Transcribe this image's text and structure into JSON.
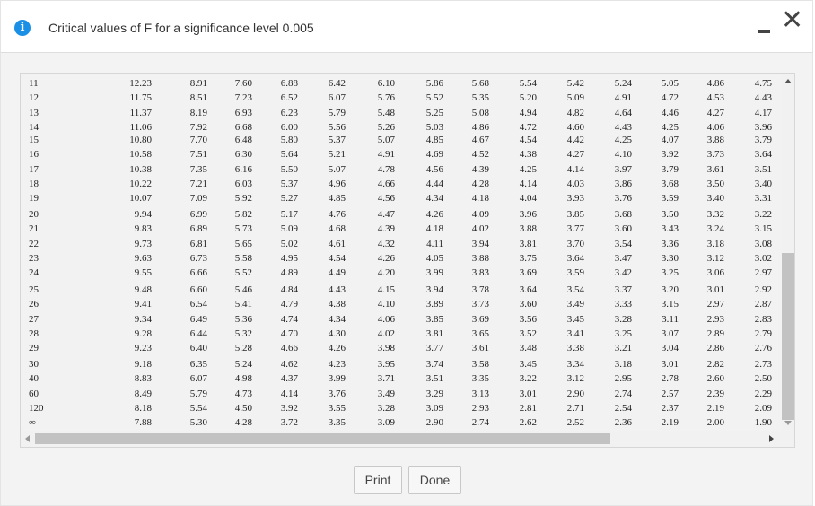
{
  "dialog": {
    "title": "Critical values of F for a significance level 0.005",
    "info_icon": "info-icon",
    "info_glyph": "i",
    "close_glyph": "✕"
  },
  "table": {
    "groups": [
      {
        "rows": [
          {
            "df": "11",
            "values": [
              "12.23",
              "8.91",
              "7.60",
              "6.88",
              "6.42",
              "6.10",
              "5.86",
              "5.68",
              "5.54",
              "5.42",
              "5.24",
              "5.05",
              "4.86",
              "4.75"
            ]
          },
          {
            "df": "12",
            "values": [
              "11.75",
              "8.51",
              "7.23",
              "6.52",
              "6.07",
              "5.76",
              "5.52",
              "5.35",
              "5.20",
              "5.09",
              "4.91",
              "4.72",
              "4.53",
              "4.43"
            ]
          },
          {
            "df": "13",
            "values": [
              "11.37",
              "8.19",
              "6.93",
              "6.23",
              "5.79",
              "5.48",
              "5.25",
              "5.08",
              "4.94",
              "4.82",
              "4.64",
              "4.46",
              "4.27",
              "4.17"
            ]
          },
          {
            "df": "14",
            "values": [
              "11.06",
              "7.92",
              "6.68",
              "6.00",
              "5.56",
              "5.26",
              "5.03",
              "4.86",
              "4.72",
              "4.60",
              "4.43",
              "4.25",
              "4.06",
              "3.96"
            ]
          }
        ]
      },
      {
        "rows": [
          {
            "df": "15",
            "values": [
              "10.80",
              "7.70",
              "6.48",
              "5.80",
              "5.37",
              "5.07",
              "4.85",
              "4.67",
              "4.54",
              "4.42",
              "4.25",
              "4.07",
              "3.88",
              "3.79"
            ]
          },
          {
            "df": "16",
            "values": [
              "10.58",
              "7.51",
              "6.30",
              "5.64",
              "5.21",
              "4.91",
              "4.69",
              "4.52",
              "4.38",
              "4.27",
              "4.10",
              "3.92",
              "3.73",
              "3.64"
            ]
          },
          {
            "df": "17",
            "values": [
              "10.38",
              "7.35",
              "6.16",
              "5.50",
              "5.07",
              "4.78",
              "4.56",
              "4.39",
              "4.25",
              "4.14",
              "3.97",
              "3.79",
              "3.61",
              "3.51"
            ]
          },
          {
            "df": "18",
            "values": [
              "10.22",
              "7.21",
              "6.03",
              "5.37",
              "4.96",
              "4.66",
              "4.44",
              "4.28",
              "4.14",
              "4.03",
              "3.86",
              "3.68",
              "3.50",
              "3.40"
            ]
          },
          {
            "df": "19",
            "values": [
              "10.07",
              "7.09",
              "5.92",
              "5.27",
              "4.85",
              "4.56",
              "4.34",
              "4.18",
              "4.04",
              "3.93",
              "3.76",
              "3.59",
              "3.40",
              "3.31"
            ]
          }
        ]
      },
      {
        "rows": [
          {
            "df": "20",
            "values": [
              "9.94",
              "6.99",
              "5.82",
              "5.17",
              "4.76",
              "4.47",
              "4.26",
              "4.09",
              "3.96",
              "3.85",
              "3.68",
              "3.50",
              "3.32",
              "3.22"
            ]
          },
          {
            "df": "21",
            "values": [
              "9.83",
              "6.89",
              "5.73",
              "5.09",
              "4.68",
              "4.39",
              "4.18",
              "4.02",
              "3.88",
              "3.77",
              "3.60",
              "3.43",
              "3.24",
              "3.15"
            ]
          },
          {
            "df": "22",
            "values": [
              "9.73",
              "6.81",
              "5.65",
              "5.02",
              "4.61",
              "4.32",
              "4.11",
              "3.94",
              "3.81",
              "3.70",
              "3.54",
              "3.36",
              "3.18",
              "3.08"
            ]
          },
          {
            "df": "23",
            "values": [
              "9.63",
              "6.73",
              "5.58",
              "4.95",
              "4.54",
              "4.26",
              "4.05",
              "3.88",
              "3.75",
              "3.64",
              "3.47",
              "3.30",
              "3.12",
              "3.02"
            ]
          },
          {
            "df": "24",
            "values": [
              "9.55",
              "6.66",
              "5.52",
              "4.89",
              "4.49",
              "4.20",
              "3.99",
              "3.83",
              "3.69",
              "3.59",
              "3.42",
              "3.25",
              "3.06",
              "2.97"
            ]
          }
        ]
      },
      {
        "rows": [
          {
            "df": "25",
            "values": [
              "9.48",
              "6.60",
              "5.46",
              "4.84",
              "4.43",
              "4.15",
              "3.94",
              "3.78",
              "3.64",
              "3.54",
              "3.37",
              "3.20",
              "3.01",
              "2.92"
            ]
          },
          {
            "df": "26",
            "values": [
              "9.41",
              "6.54",
              "5.41",
              "4.79",
              "4.38",
              "4.10",
              "3.89",
              "3.73",
              "3.60",
              "3.49",
              "3.33",
              "3.15",
              "2.97",
              "2.87"
            ]
          },
          {
            "df": "27",
            "values": [
              "9.34",
              "6.49",
              "5.36",
              "4.74",
              "4.34",
              "4.06",
              "3.85",
              "3.69",
              "3.56",
              "3.45",
              "3.28",
              "3.11",
              "2.93",
              "2.83"
            ]
          },
          {
            "df": "28",
            "values": [
              "9.28",
              "6.44",
              "5.32",
              "4.70",
              "4.30",
              "4.02",
              "3.81",
              "3.65",
              "3.52",
              "3.41",
              "3.25",
              "3.07",
              "2.89",
              "2.79"
            ]
          },
          {
            "df": "29",
            "values": [
              "9.23",
              "6.40",
              "5.28",
              "4.66",
              "4.26",
              "3.98",
              "3.77",
              "3.61",
              "3.48",
              "3.38",
              "3.21",
              "3.04",
              "2.86",
              "2.76"
            ]
          }
        ]
      },
      {
        "rows": [
          {
            "df": "30",
            "values": [
              "9.18",
              "6.35",
              "5.24",
              "4.62",
              "4.23",
              "3.95",
              "3.74",
              "3.58",
              "3.45",
              "3.34",
              "3.18",
              "3.01",
              "2.82",
              "2.73"
            ]
          },
          {
            "df": "40",
            "values": [
              "8.83",
              "6.07",
              "4.98",
              "4.37",
              "3.99",
              "3.71",
              "3.51",
              "3.35",
              "3.22",
              "3.12",
              "2.95",
              "2.78",
              "2.60",
              "2.50"
            ]
          },
          {
            "df": "60",
            "values": [
              "8.49",
              "5.79",
              "4.73",
              "4.14",
              "3.76",
              "3.49",
              "3.29",
              "3.13",
              "3.01",
              "2.90",
              "2.74",
              "2.57",
              "2.39",
              "2.29"
            ]
          },
          {
            "df": "120",
            "values": [
              "8.18",
              "5.54",
              "4.50",
              "3.92",
              "3.55",
              "3.28",
              "3.09",
              "2.93",
              "2.81",
              "2.71",
              "2.54",
              "2.37",
              "2.19",
              "2.09"
            ]
          },
          {
            "df": "∞",
            "values": [
              "7.88",
              "5.30",
              "4.28",
              "3.72",
              "3.35",
              "3.09",
              "2.90",
              "2.74",
              "2.62",
              "2.52",
              "2.36",
              "2.19",
              "2.00",
              "1.90"
            ]
          }
        ]
      }
    ]
  },
  "buttons": {
    "print_label": "Print",
    "done_label": "Done"
  }
}
